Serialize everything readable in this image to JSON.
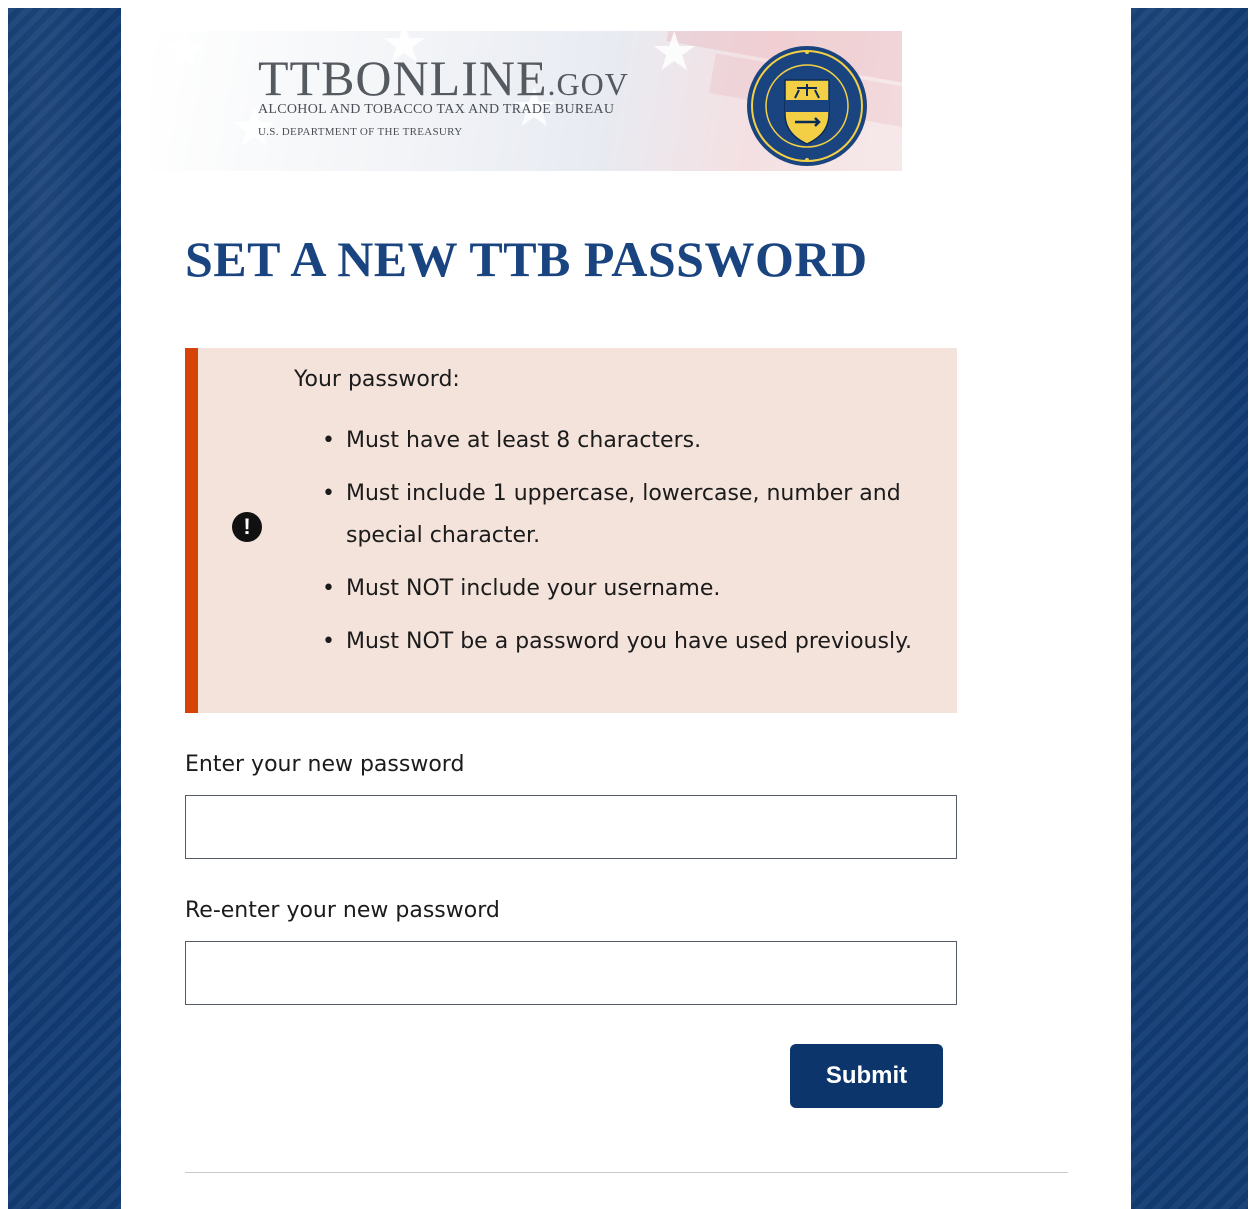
{
  "header": {
    "logo_main": "TTBONLINE",
    "logo_gov": ".GOV",
    "logo_bureau": "ALCOHOL AND TOBACCO TAX AND TRADE BUREAU",
    "logo_department": "U.S. DEPARTMENT OF THE TREASURY",
    "seal_icon": "ttb-seal-icon"
  },
  "page": {
    "title": "SET A NEW TTB PASSWORD"
  },
  "alert": {
    "icon": "exclamation-icon",
    "heading": "Your password:",
    "rules": [
      "Must have at least 8 characters.",
      "Must include 1 uppercase, lowercase, number and special character.",
      "Must NOT include your username.",
      "Must NOT be a password you have used previously."
    ]
  },
  "form": {
    "new_password_label": "Enter your new password",
    "new_password_value": "",
    "confirm_password_label": "Re-enter your new password",
    "confirm_password_value": "",
    "submit_label": "Submit"
  },
  "colors": {
    "primary": "#1a4480",
    "button": "#0c366b",
    "alert_border": "#d54309",
    "alert_bg": "#f4e3db",
    "side_bg": "#133d75"
  }
}
